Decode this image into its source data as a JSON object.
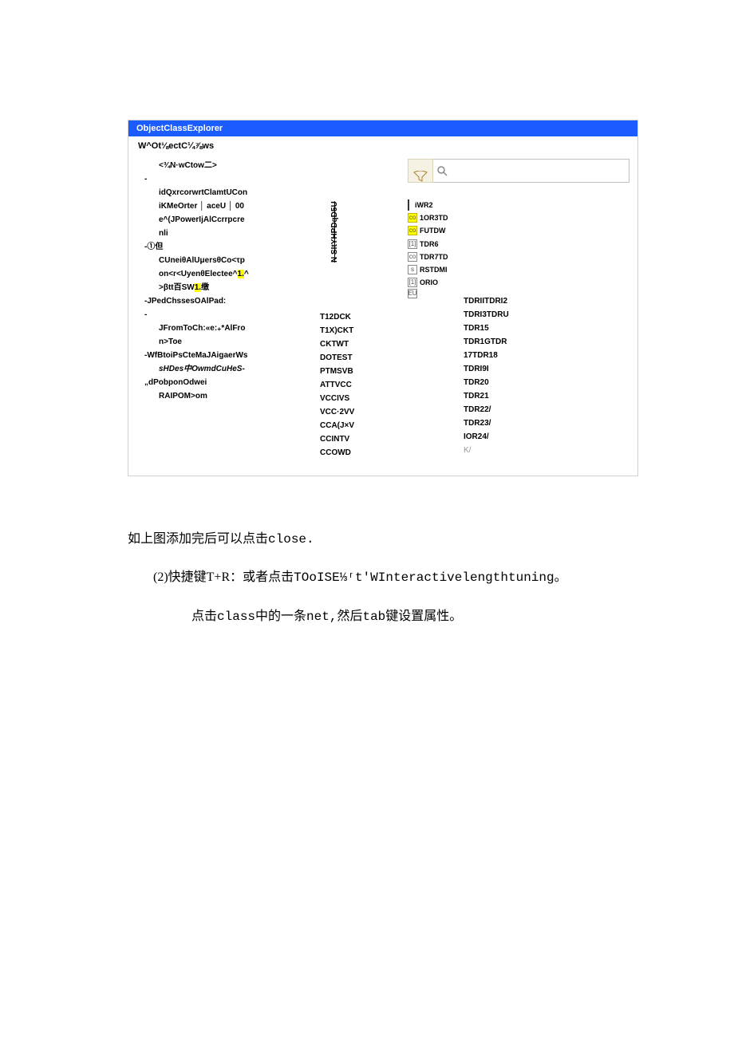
{
  "window": {
    "title": "ObjectClassExplorer",
    "subheader": "W^Ot⅛ectC¼⅞ws",
    "breadcrumb": "<¾N·wCtow二>"
  },
  "leftCol": {
    "l1": "idQxrcorwrtClamtUCon",
    "l2": "iKMeOrter │ aceU │ 00",
    "l3": "e^(JPowerIjAlCcrrpcre",
    "l4": "nli",
    "l5": "-①但",
    "l6": "CUneiθAlUμersθCo<τp",
    "l7": "on<r<UyenθElectee^",
    "l7hl": "1.",
    "l7b": "^",
    "l8a": ">βtt百SW",
    "l8hl": "1.",
    "l8b": "缴",
    "l9": "-JPedChssesOAlPad:",
    "l10": "JFromToCh:«e:₊*AlFro",
    "l11": "n>Toe",
    "l12": "-WfBtoiPsCteMaJAigaerWs",
    "l13": "sHDes中OwmdCuHeS-",
    "l14": "„dPobponOdwei",
    "l15": "RAIPOM>om"
  },
  "vertLabel": "N SItYHPDqD5U",
  "midList": [
    "T12DCK",
    "T1X)CKT",
    "CKTWT",
    "DOTEST",
    "PTMSVB",
    "ATTVCC",
    "VCCIVS",
    "VCC·2VV",
    "CCA(J×V",
    "CCINTV",
    "CCOWD"
  ],
  "tree": [
    {
      "icon": "|",
      "label": "iWR2"
    },
    {
      "icon": "co",
      "label": "1OR3TD",
      "hl": true
    },
    {
      "icon": "co",
      "label": "FUTDW",
      "hl": true
    },
    {
      "icon": "[1]",
      "label": "TDR6"
    },
    {
      "icon": "co",
      "label": "TDR7TD"
    },
    {
      "icon": "s",
      "label": "RSTDMI"
    },
    {
      "icon": "[1]",
      "label": "ORIO"
    },
    {
      "icon": "EU",
      "label": ""
    }
  ],
  "netList": [
    "TDRIITDRI2",
    "TDRI3TDRU",
    "TDR15",
    "TDR1GTDR",
    "17TDR18",
    "TDRI9I",
    "TDR20",
    "TDR21",
    "TDR22/",
    "TDR23/",
    "IOR24/"
  ],
  "netListGray": "K/",
  "body": {
    "p1a": "如上图添加完后可以点击",
    "p1b": "close.",
    "p2a": "(2)快捷键T+R：或者点击",
    "p2b": "TOoISE⅓ʳt′WInteractivelengthtuning",
    "p2c": "。",
    "p3a": "点击",
    "p3b": "class",
    "p3c": "中的一条",
    "p3d": "net,",
    "p3e": "然后",
    "p3f": "tab",
    "p3g": "键设置属性。"
  }
}
